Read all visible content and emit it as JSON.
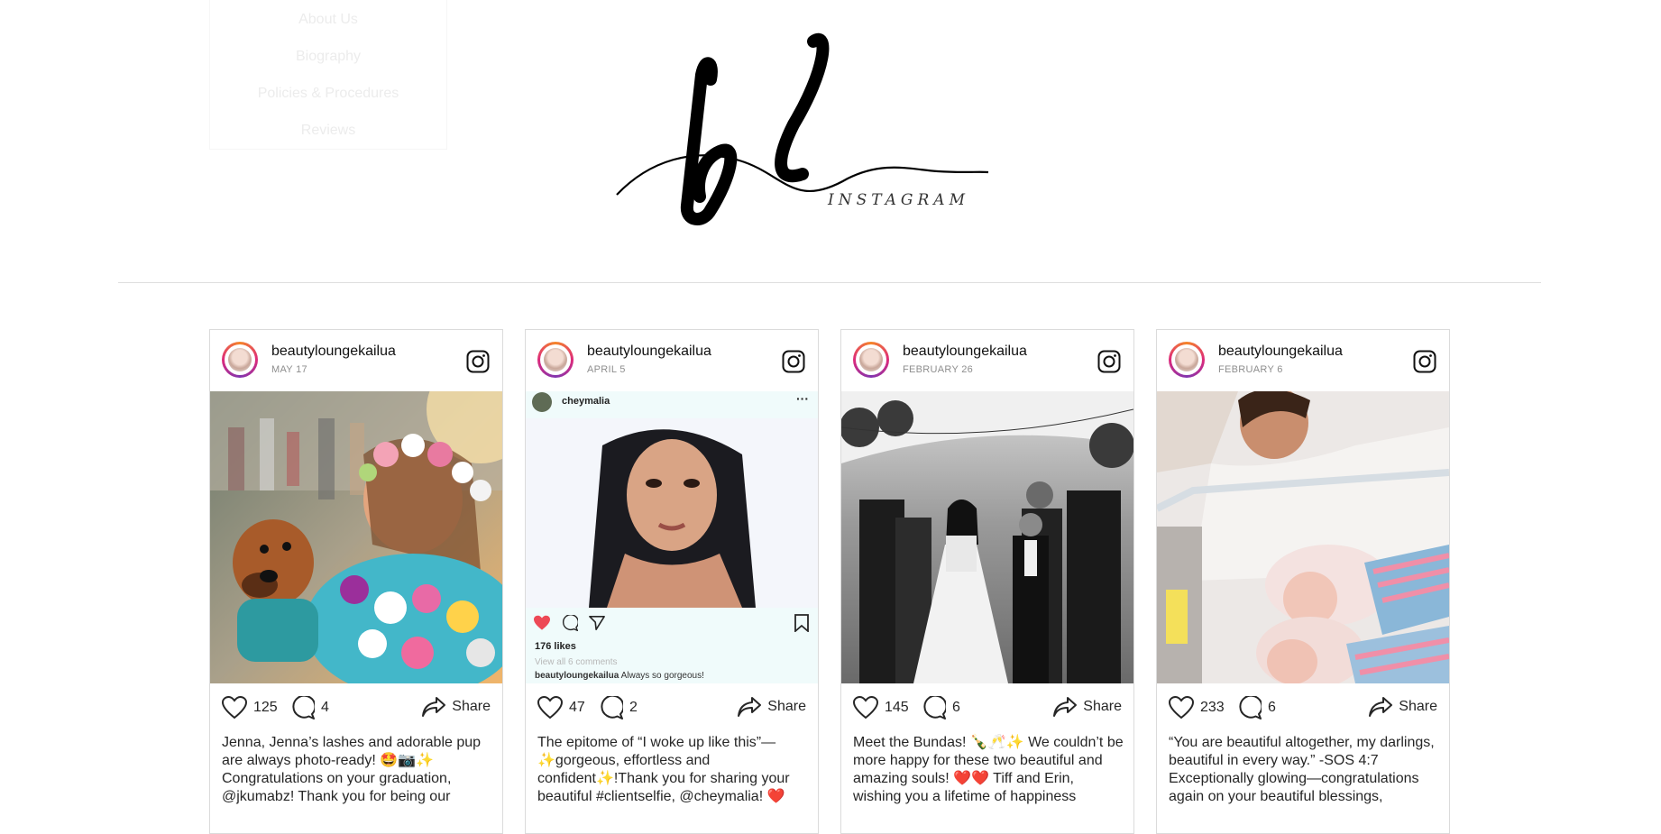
{
  "menu": {
    "items": [
      "About Us",
      "Biography",
      "Policies & Procedures",
      "Reviews"
    ]
  },
  "logo": {
    "text": "INSTAGRAM"
  },
  "posts": [
    {
      "username": "beautyloungekailua",
      "date": "MAY 17",
      "likes": "125",
      "comments": "4",
      "share": "Share",
      "caption": "Jenna, Jenna’s lashes and adorable pup are always photo-ready! 🤩📷✨ Congratulations on your graduation, @jkumabz! Thank you for being our"
    },
    {
      "username": "beautyloungekailua",
      "date": "APRIL 5",
      "likes": "47",
      "comments": "2",
      "share": "Share",
      "caption": "The epitome of “I woke up like this”—✨gorgeous, effortless and confident✨!Thank you for sharing your beautiful #clientselfie, @cheymalia! ❤️",
      "embed": {
        "username": "cheymalia",
        "likes": "176 likes",
        "view_comments": "View all 6 comments",
        "comment_user": "beautyloungekailua",
        "comment_text": "Always so gorgeous!"
      }
    },
    {
      "username": "beautyloungekailua",
      "date": "FEBRUARY 26",
      "likes": "145",
      "comments": "6",
      "share": "Share",
      "caption": "Meet the Bundas! 🍾🥂✨ We couldn’t be more happy for these two beautiful and amazing souls! ❤️❤️ Tiff and Erin, wishing you a lifetime of happiness"
    },
    {
      "username": "beautyloungekailua",
      "date": "FEBRUARY 6",
      "likes": "233",
      "comments": "6",
      "share": "Share",
      "caption": "“You are beautiful altogether, my darlings, beautiful in every way.” -SOS 4:7 Exceptionally glowing—congratulations again on your beautiful blessings,"
    }
  ]
}
